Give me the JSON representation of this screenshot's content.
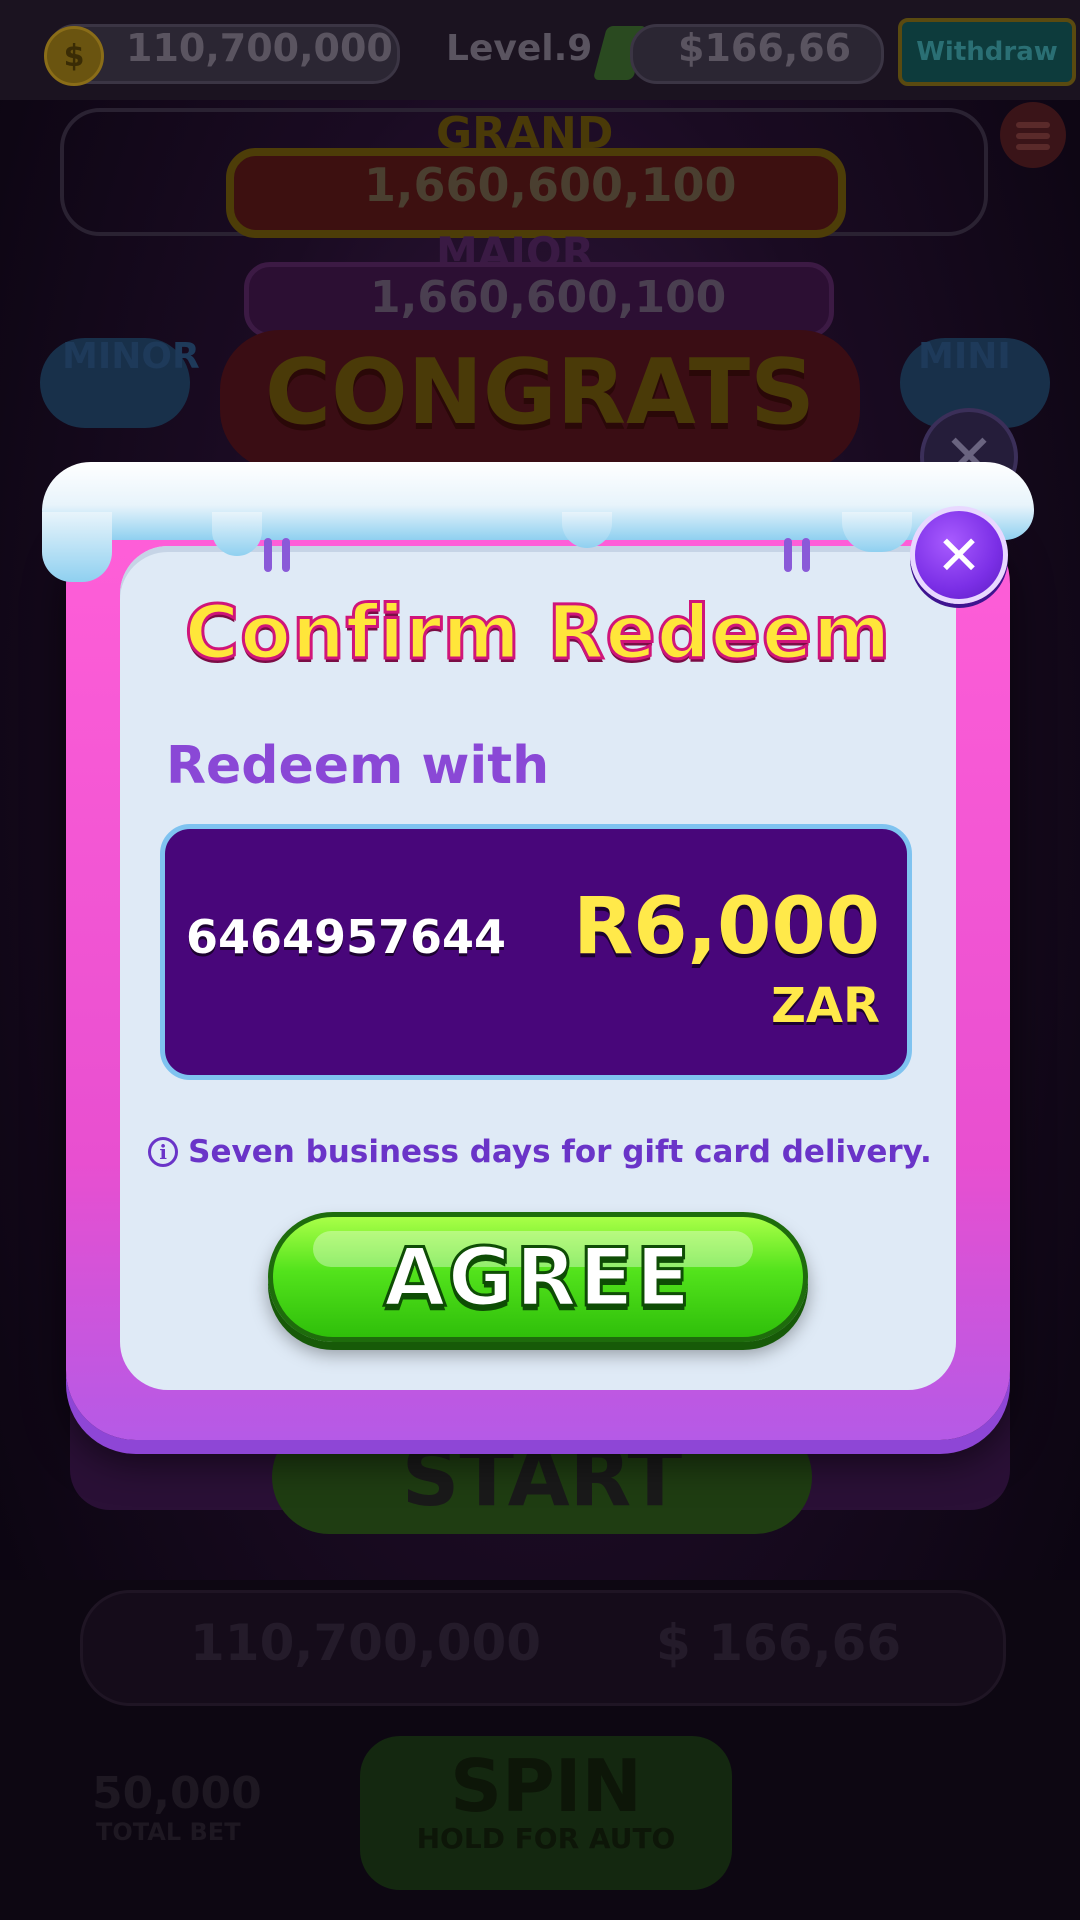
{
  "background": {
    "coin_balance": "110,700,000",
    "level": "Level.9",
    "cash_balance": "$166,66",
    "withdraw_label": "Withdraw",
    "jackpots": {
      "grand_label": "GRAND",
      "grand_value": "1,660,600,100",
      "major_label": "MAJOR",
      "major_value": "1,660,600,100",
      "minor_label": "MINOR",
      "mini_label": "MINI"
    },
    "banner": "CONGRATS",
    "start_label": "START",
    "bottom_coins": "110,700,000",
    "bottom_cash": "$ 166,66",
    "total_bet_value": "50,000",
    "total_bet_label": "TOTAL BET",
    "spin_label": "SPIN",
    "spin_hint": "HOLD FOR AUTO"
  },
  "dialog": {
    "title": "Confirm Redeem",
    "subtitle": "Redeem with",
    "account_number": "6464957644",
    "amount": "R6,000",
    "currency": "ZAR",
    "info_text": "Seven business days for gift card delivery.",
    "agree_label": "AGREE",
    "close_symbol": "✕"
  },
  "colors": {
    "dialog_frame": "#ff5fd8",
    "dialog_body": "#dfeaf6",
    "card_bg": "#48067a",
    "title_yellow": "#ffe63a",
    "agree_green": "#53e31c",
    "close_purple": "#7b2fe6"
  }
}
